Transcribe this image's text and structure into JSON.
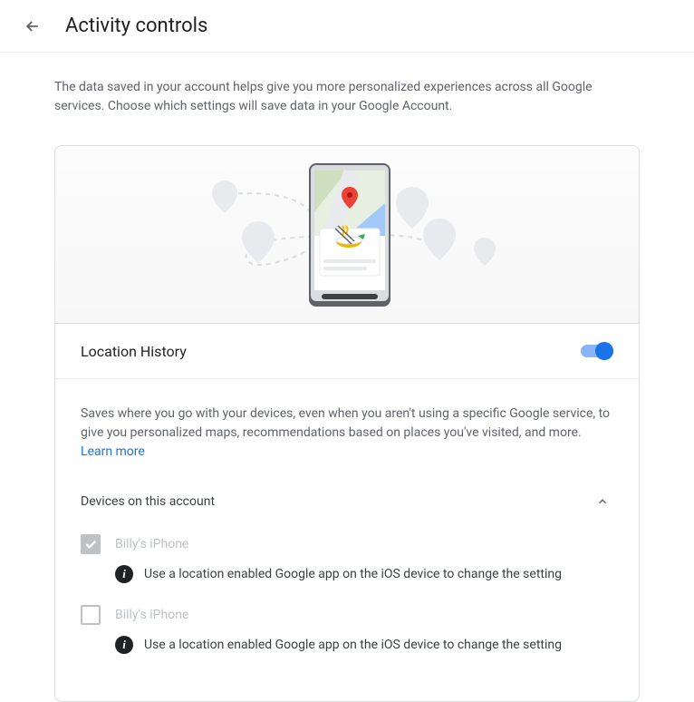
{
  "header": {
    "title": "Activity controls"
  },
  "intro": "The data saved in your account helps give you more personalized experiences across all Google services. Choose which settings will save data in your Google Account.",
  "section": {
    "title": "Location History",
    "toggle_on": true,
    "description": "Saves where you go with your devices, even when you aren't using a specific Google service, to give you personalized maps, recommendations based on places you've visited, and more. ",
    "learn_more": "Learn more"
  },
  "devices": {
    "title": "Devices on this account",
    "items": [
      {
        "name": "Billy's iPhone",
        "checked": true,
        "hint": "Use a location enabled Google app on the iOS device to change the setting"
      },
      {
        "name": "Billy's iPhone",
        "checked": false,
        "hint": "Use a location enabled Google app on the iOS device to change the setting"
      }
    ]
  }
}
